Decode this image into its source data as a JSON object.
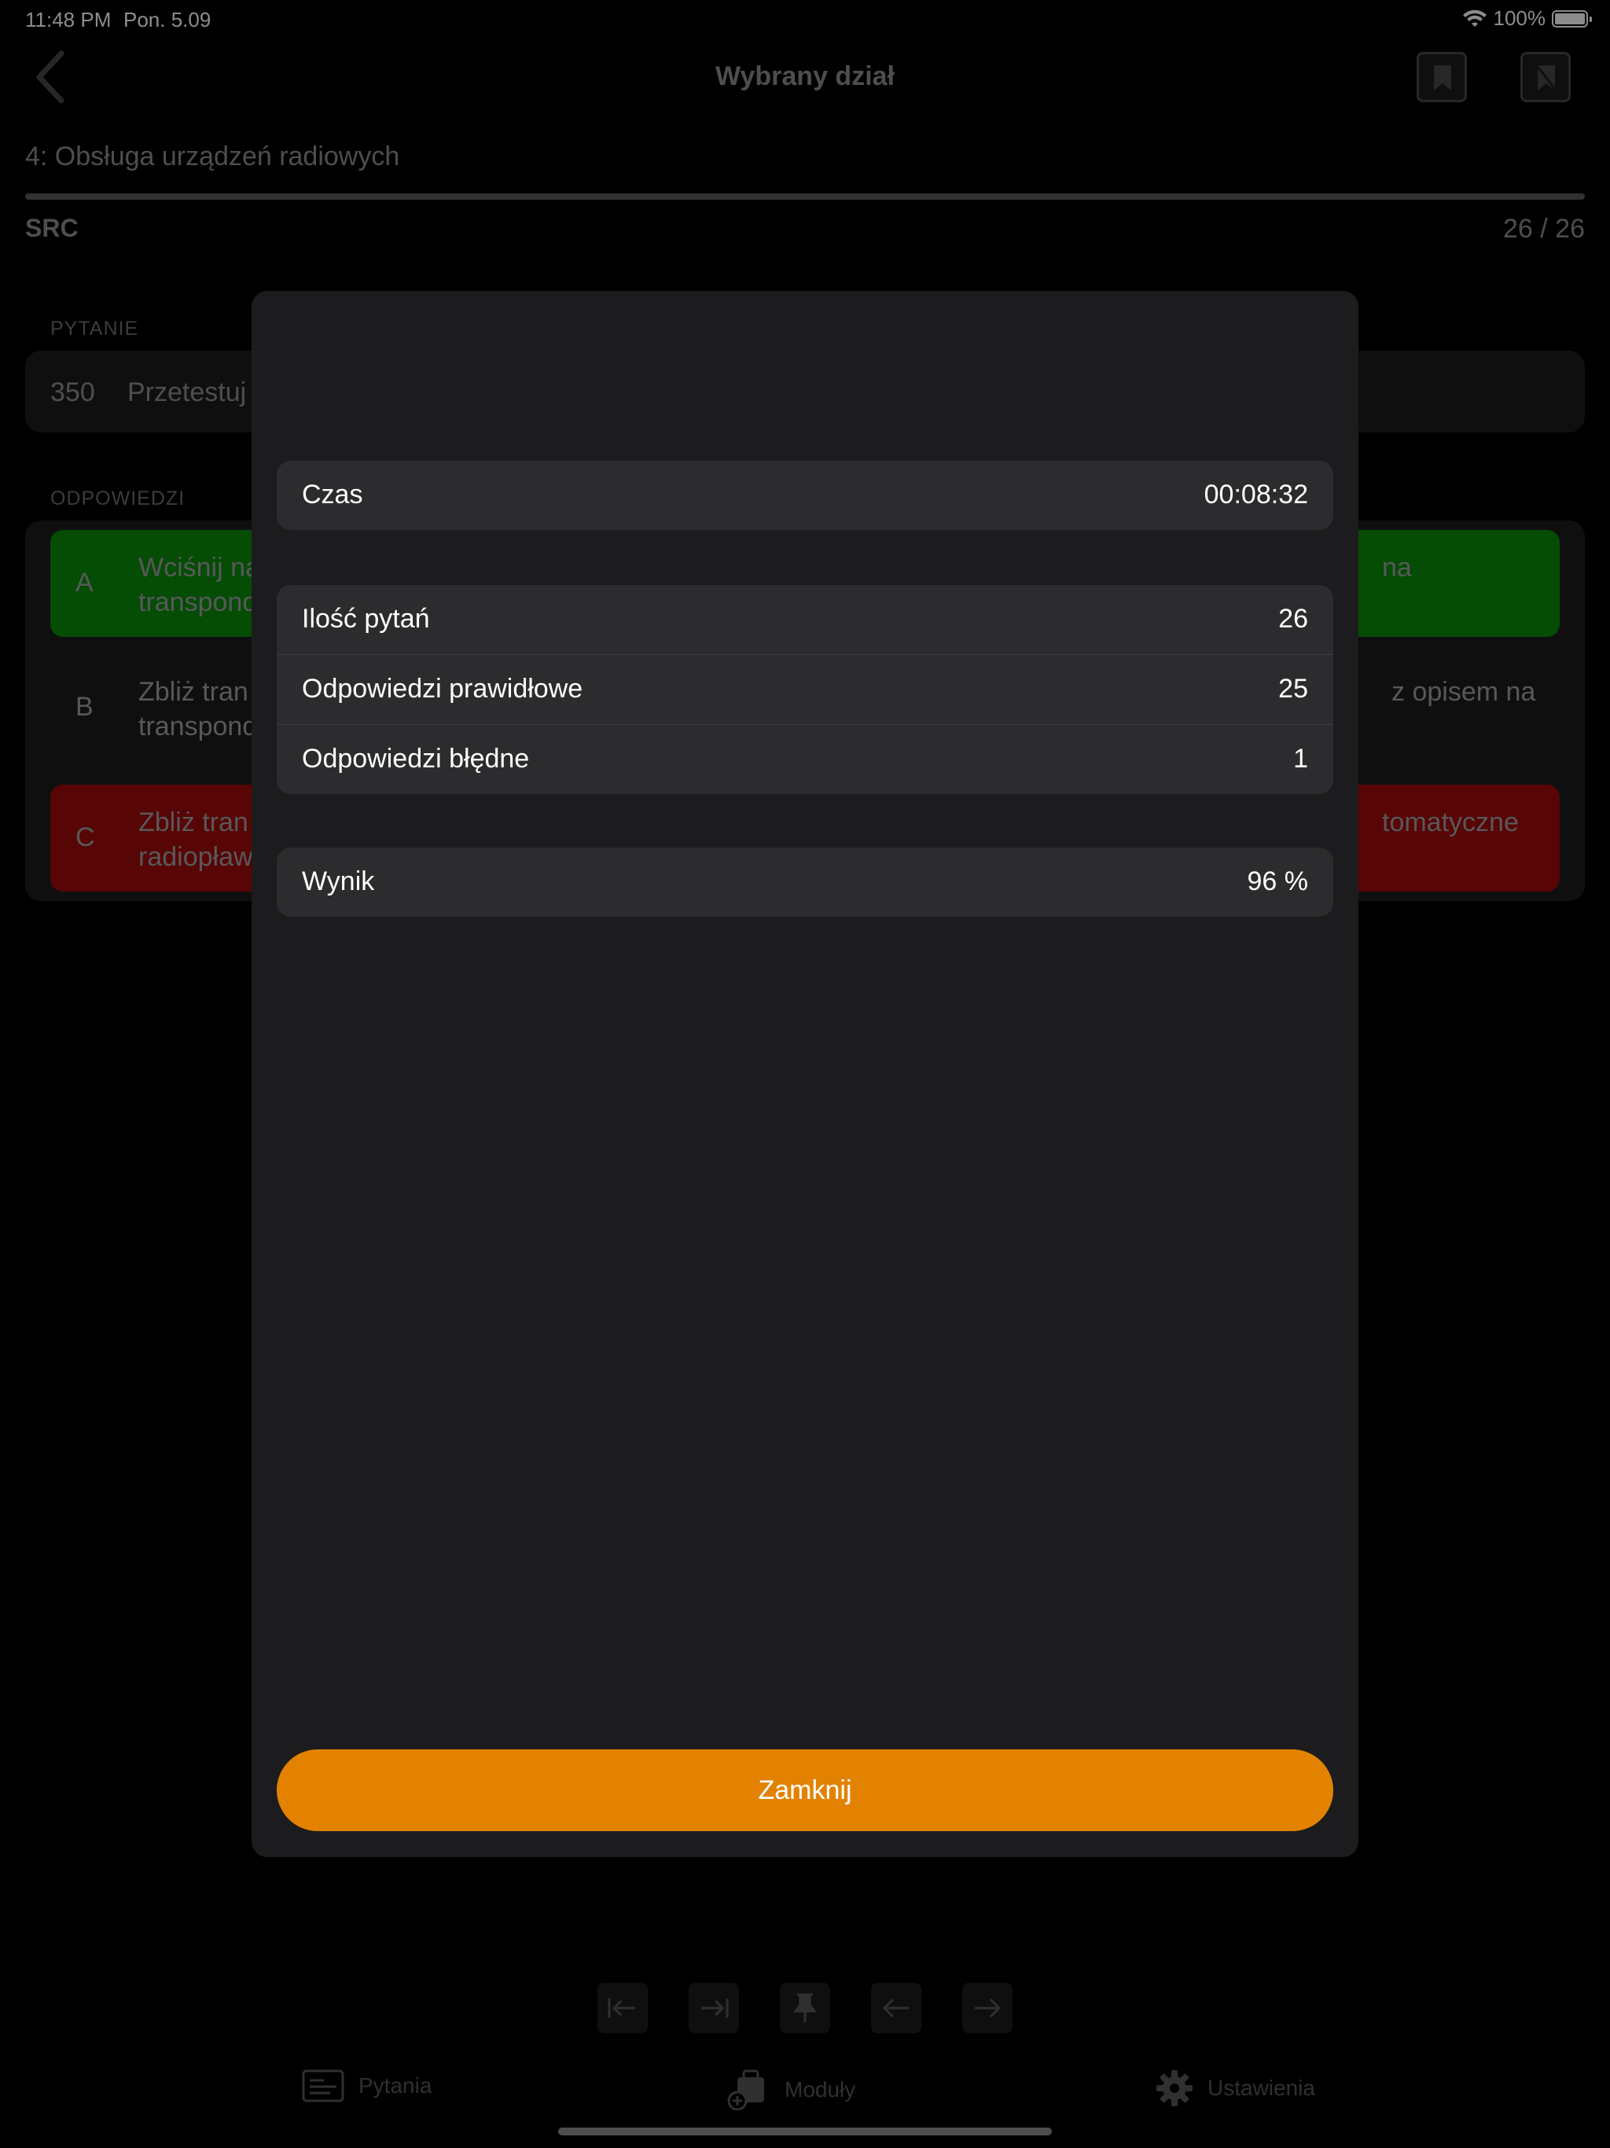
{
  "status_bar": {
    "time": "11:48 PM",
    "date": "Pon. 5.09",
    "battery": "100%",
    "battery_level": 1.0
  },
  "nav": {
    "title": "Wybrany dział"
  },
  "section": {
    "title": "4:  Obsługa urządzeń radiowych",
    "module": "SRC",
    "counter": "26  /  26",
    "progress": 1.0
  },
  "question": {
    "group_label": "PYTANIE",
    "number": "350",
    "text_visible": "Przetestuj"
  },
  "answers": {
    "group_label": "ODPOWIEDZI",
    "items": [
      {
        "letter": "A",
        "line1": "Wciśnij na",
        "line2": "transpond",
        "tail": "na",
        "state": "correct"
      },
      {
        "letter": "B",
        "line1": "Zbliż tran",
        "line2": "transpond",
        "tail": "z opisem na",
        "state": "neutral"
      },
      {
        "letter": "C",
        "line1": "Zbliż tran",
        "line2": "radiopław",
        "tail": "tomatyczne",
        "state": "wrong"
      }
    ]
  },
  "colors": {
    "correct": "#0a8a0a",
    "wrong": "#a00a0a",
    "accent": "#e38200",
    "modal_bg": "#1c1c1e",
    "row_bg": "#2c2c2e"
  },
  "toolbar": {
    "icons": [
      "first-page-icon",
      "last-page-icon",
      "pin-icon",
      "arrow-left-icon",
      "arrow-right-icon"
    ]
  },
  "tabbar": {
    "items": [
      {
        "label": "Pytania",
        "icon": "questions-icon"
      },
      {
        "label": "Moduły",
        "icon": "modules-icon"
      },
      {
        "label": "Ustawienia",
        "icon": "gear-icon"
      }
    ]
  },
  "results": {
    "time": {
      "label": "Czas",
      "value": "00:08:32"
    },
    "stats": [
      {
        "label": "Ilość pytań",
        "value": "26"
      },
      {
        "label": "Odpowiedzi prawidłowe",
        "value": "25"
      },
      {
        "label": "Odpowiedzi błędne",
        "value": "1"
      }
    ],
    "score": {
      "label": "Wynik",
      "value": "96 %"
    },
    "close_label": "Zamknij"
  }
}
